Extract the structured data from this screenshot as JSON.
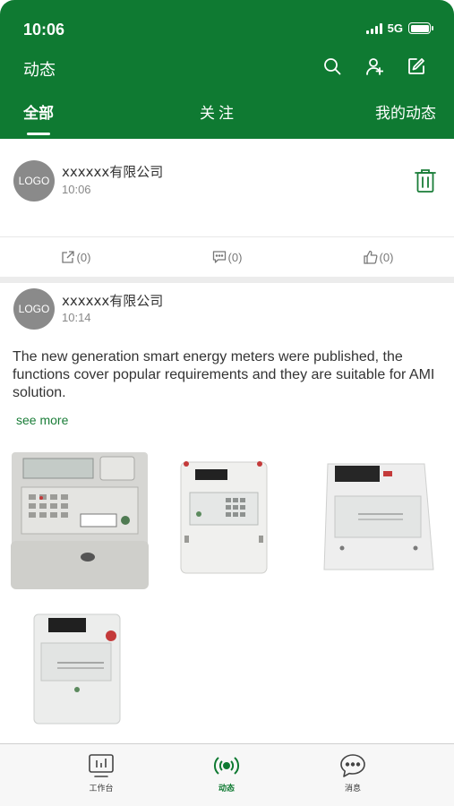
{
  "status_bar": {
    "time": "10:06",
    "network": "5G"
  },
  "header": {
    "title": "动态",
    "icons": [
      "search-icon",
      "add-user-icon",
      "edit-icon"
    ],
    "tabs": [
      {
        "label": "全部",
        "active": true
      },
      {
        "label": "关注",
        "active": false
      },
      {
        "label": "我的动态",
        "active": false
      }
    ]
  },
  "posts": [
    {
      "avatar_text": "LOGO",
      "company": "xxxxxx有限公司",
      "time": "10:06",
      "actions": {
        "share": "(0)",
        "comment": "(0)",
        "like": "(0)"
      }
    },
    {
      "avatar_text": "LOGO",
      "company": "xxxxxx有限公司",
      "time": "10:14",
      "text": "The new generation smart energy meters were published, the functions cover popular requirements and they are suitable for AMI solution.",
      "see_more": "see more",
      "images": [
        "smart-meter-photo-1",
        "smart-meter-photo-2",
        "smart-meter-photo-3",
        "smart-meter-photo-4"
      ]
    }
  ],
  "tabbar": {
    "items": [
      {
        "label": "工作台",
        "icon": "workbench-icon",
        "active": false
      },
      {
        "label": "动态",
        "icon": "broadcast-icon",
        "active": true
      },
      {
        "label": "消息",
        "icon": "message-icon",
        "active": false
      }
    ]
  },
  "colors": {
    "brand_green": "#0f7a32",
    "link_green": "#1a7d38",
    "avatar_gray": "#8a8a8a"
  }
}
